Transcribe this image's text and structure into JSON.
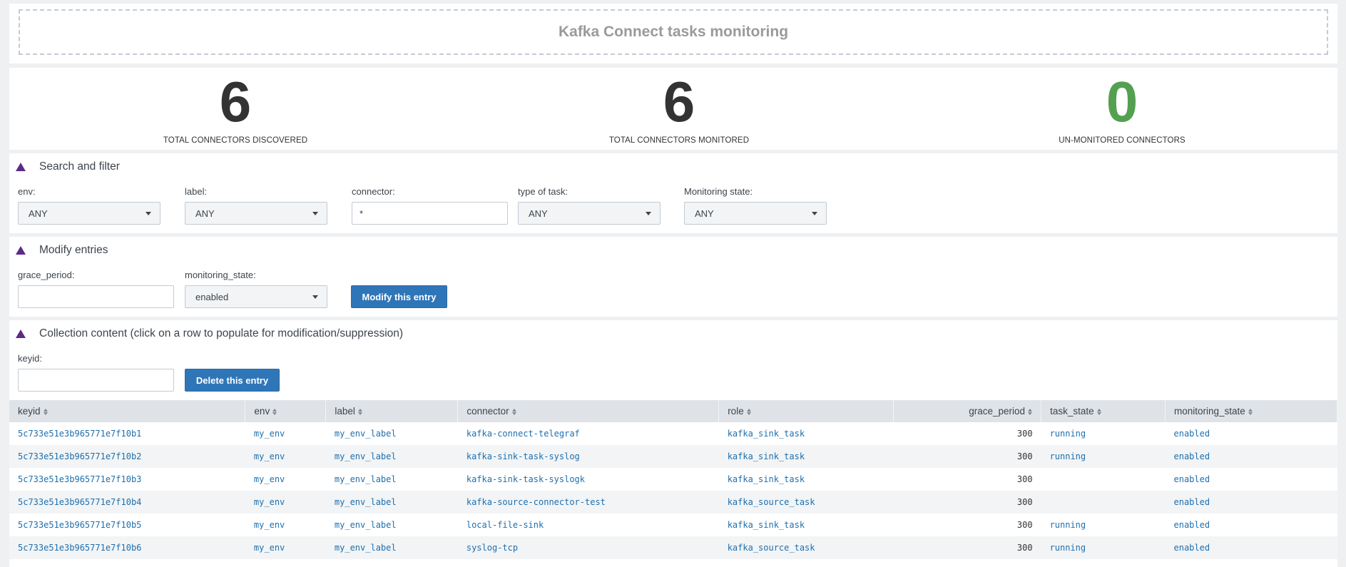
{
  "header": {
    "title": "Kafka Connect tasks monitoring"
  },
  "kpis": [
    {
      "value": "6",
      "label": "TOTAL CONNECTORS DISCOVERED"
    },
    {
      "value": "6",
      "label": "TOTAL CONNECTORS MONITORED"
    },
    {
      "value": "0",
      "label": "UN-MONITORED CONNECTORS",
      "color": "#53a051"
    }
  ],
  "search": {
    "title": "Search and filter",
    "env": {
      "label": "env:",
      "value": "ANY"
    },
    "label_f": {
      "label": "label:",
      "value": "ANY"
    },
    "connector": {
      "label": "connector:",
      "value": "*"
    },
    "task_type": {
      "label": "type of task:",
      "value": "ANY"
    },
    "monitoring_state": {
      "label": "Monitoring state:",
      "value": "ANY"
    }
  },
  "modify": {
    "title": "Modify entries",
    "grace_label": "grace_period:",
    "grace_value": "",
    "state_label": "monitoring_state:",
    "state_value": "enabled",
    "button": "Modify this entry"
  },
  "collection": {
    "title": "Collection content (click on a row to populate for modification/suppression)",
    "keyid_label": "keyid:",
    "keyid_value": "",
    "delete_button": "Delete this entry",
    "columns": [
      "keyid",
      "env",
      "label",
      "connector",
      "role",
      "grace_period",
      "task_state",
      "monitoring_state"
    ],
    "rows": [
      [
        "5c733e51e3b965771e7f10b1",
        "my_env",
        "my_env_label",
        "kafka-connect-telegraf",
        "kafka_sink_task",
        "300",
        "running",
        "enabled"
      ],
      [
        "5c733e51e3b965771e7f10b2",
        "my_env",
        "my_env_label",
        "kafka-sink-task-syslog",
        "kafka_sink_task",
        "300",
        "running",
        "enabled"
      ],
      [
        "5c733e51e3b965771e7f10b3",
        "my_env",
        "my_env_label",
        "kafka-sink-task-syslogk",
        "kafka_sink_task",
        "300",
        "",
        "enabled"
      ],
      [
        "5c733e51e3b965771e7f10b4",
        "my_env",
        "my_env_label",
        "kafka-source-connector-test",
        "kafka_source_task",
        "300",
        "",
        "enabled"
      ],
      [
        "5c733e51e3b965771e7f10b5",
        "my_env",
        "my_env_label",
        "local-file-sink",
        "kafka_sink_task",
        "300",
        "running",
        "enabled"
      ],
      [
        "5c733e51e3b965771e7f10b6",
        "my_env",
        "my_env_label",
        "syslog-tcp",
        "kafka_source_task",
        "300",
        "running",
        "enabled"
      ]
    ]
  },
  "colors": {
    "accent": "#2f76b8",
    "triangle": "#5c2a88",
    "link": "#1e6fae",
    "ok": "#53a051"
  }
}
